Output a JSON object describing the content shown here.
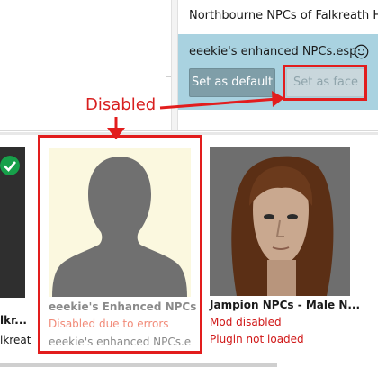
{
  "top": {
    "plugin_row_plain": "Northbourne NPCs of Falkreath Ho",
    "plugin_row_selected": "eeekie's enhanced NPCs.esp",
    "set_default_label": "Set as default",
    "set_face_label": "Set as face",
    "face_button_state": "disabled"
  },
  "annotation": {
    "label": "Disabled",
    "color": "#d81f1f"
  },
  "cards": [
    {
      "title": "lkr...",
      "subtitle": "lkreat",
      "status": "check",
      "status_color": "#17a04a"
    },
    {
      "title": "eeekie's Enhanced NPCs",
      "status_line": "Disabled due to errors",
      "plugin": "eeekie's enhanced NPCs.esp",
      "placeholder_bg": "#fbf8df",
      "status_color": "#f18a78"
    },
    {
      "title": "Jampion NPCs - Male N...",
      "status_line_1": "Mod disabled",
      "status_line_2": "Plugin not loaded",
      "status_color": "#d01717"
    }
  ],
  "colors": {
    "selected_row_bg": "#a9d2e0",
    "default_button_bg": "#7f9ea8",
    "highlight_red": "#e21d1d"
  }
}
